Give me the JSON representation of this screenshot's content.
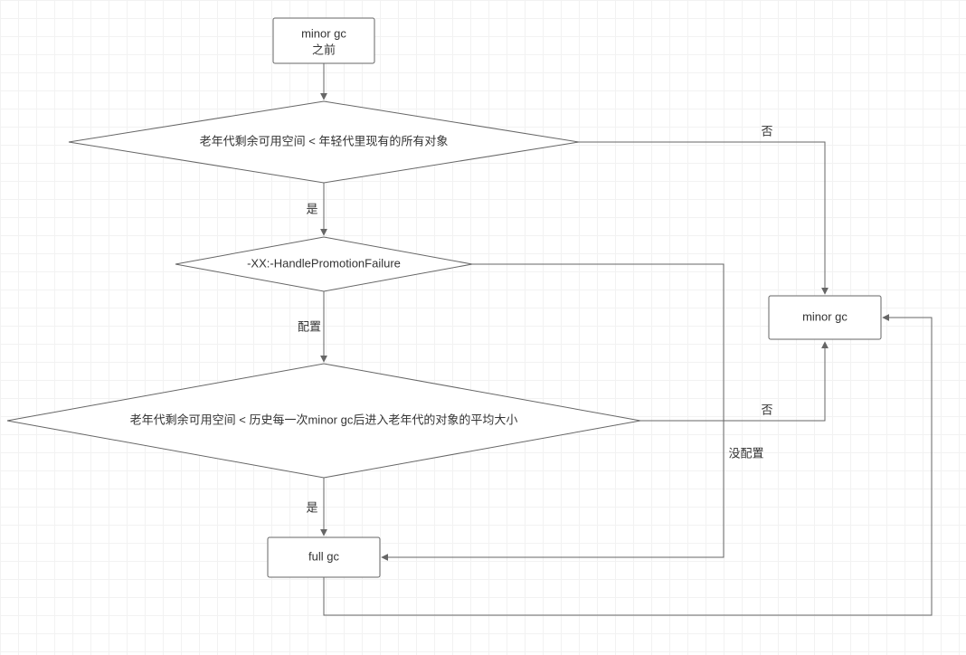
{
  "chart_data": {
    "type": "flowchart",
    "nodes": {
      "start": {
        "shape": "rect",
        "text_lines": [
          "minor gc",
          "之前"
        ]
      },
      "d1": {
        "shape": "diamond",
        "text": "老年代剩余可用空间 < 年轻代里现有的所有对象"
      },
      "d2": {
        "shape": "diamond",
        "text": "-XX:-HandlePromotionFailure"
      },
      "d3": {
        "shape": "diamond",
        "text": "老年代剩余可用空间 < 历史每一次minor gc后进入老年代的对象的平均大小"
      },
      "full": {
        "shape": "rect",
        "text": "full gc"
      },
      "minor": {
        "shape": "rect",
        "text": "minor gc"
      }
    },
    "edges": [
      {
        "from": "start",
        "to": "d1",
        "label": ""
      },
      {
        "from": "d1",
        "to": "d2",
        "label": "是"
      },
      {
        "from": "d1",
        "to": "minor",
        "label": "否"
      },
      {
        "from": "d2",
        "to": "d3",
        "label": "配置"
      },
      {
        "from": "d2",
        "to": "full",
        "label": "没配置"
      },
      {
        "from": "d3",
        "to": "full",
        "label": "是"
      },
      {
        "from": "d3",
        "to": "minor",
        "label": "否"
      },
      {
        "from": "full",
        "to": "minor",
        "label": ""
      }
    ]
  }
}
